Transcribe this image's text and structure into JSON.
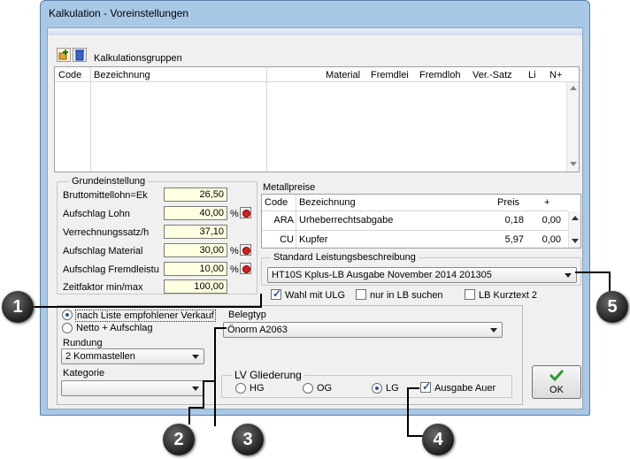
{
  "window": {
    "title": "Kalkulation - Voreinstellungen"
  },
  "kalkulationsgruppen": {
    "label": "Kalkulationsgruppen",
    "columns": [
      "Code",
      "Bezeichnung",
      "Material",
      "Fremdlei",
      "Fremdloh",
      "Ver.-Satz",
      "Li",
      "N+"
    ]
  },
  "grundeinstellung": {
    "legend": "Grundeinstellung",
    "fields": [
      {
        "label": "Bruttomittellohn=Ek",
        "value": "26,50"
      },
      {
        "label": "Aufschlag Lohn",
        "value": "40,00",
        "unit": "%"
      },
      {
        "label": "Verrechnungssatz/h",
        "value": "37,10"
      },
      {
        "label": "Aufschlag Material",
        "value": "30,00",
        "unit": "%"
      },
      {
        "label": "Aufschlag Fremdleistu",
        "value": "10,00",
        "unit": "%"
      },
      {
        "label": "Zeitfaktor min/max",
        "value": "100,00"
      }
    ]
  },
  "metallpreise": {
    "label": "Metallpreise",
    "columns": [
      "Code",
      "Bezeichnung",
      "Preis",
      "+"
    ],
    "rows": [
      {
        "code": "ARA",
        "name": "Urheberrechtsabgabe",
        "preis": "0,18",
        "plus": "0,00"
      },
      {
        "code": "CU",
        "name": "Kupfer",
        "preis": "5,97",
        "plus": "0,00"
      }
    ]
  },
  "standard": {
    "legend": "Standard Leistungsbeschreibung",
    "selected": "HT10S Kplus-LB Ausgabe November 2014 201305",
    "wahl_mit_ulg": "Wahl mit ULG",
    "nur_in_lb": "nur in LB suchen",
    "lb_kurztext": "LB Kurztext 2"
  },
  "preis": {
    "option1": "nach Liste empfohlener Verkauf",
    "option2": "Netto + Aufschlag",
    "rundung_label": "Rundung",
    "rundung_value": "2 Kommastellen",
    "kategorie_label": "Kategorie",
    "kategorie_value": ""
  },
  "belegtyp": {
    "label": "Belegtyp",
    "value": "Önorm A2063"
  },
  "lv": {
    "legend": "LV Gliederung",
    "hg": "HG",
    "og": "OG",
    "lg": "LG",
    "ausgabe": "Ausgabe Auer"
  },
  "ok_label": "OK",
  "callouts": [
    "1",
    "2",
    "3",
    "4",
    "5"
  ],
  "colors": {
    "accent_red": "#d61e1e",
    "ok_green": "#2e9a2e",
    "field_yellow": "#ffffe1"
  }
}
